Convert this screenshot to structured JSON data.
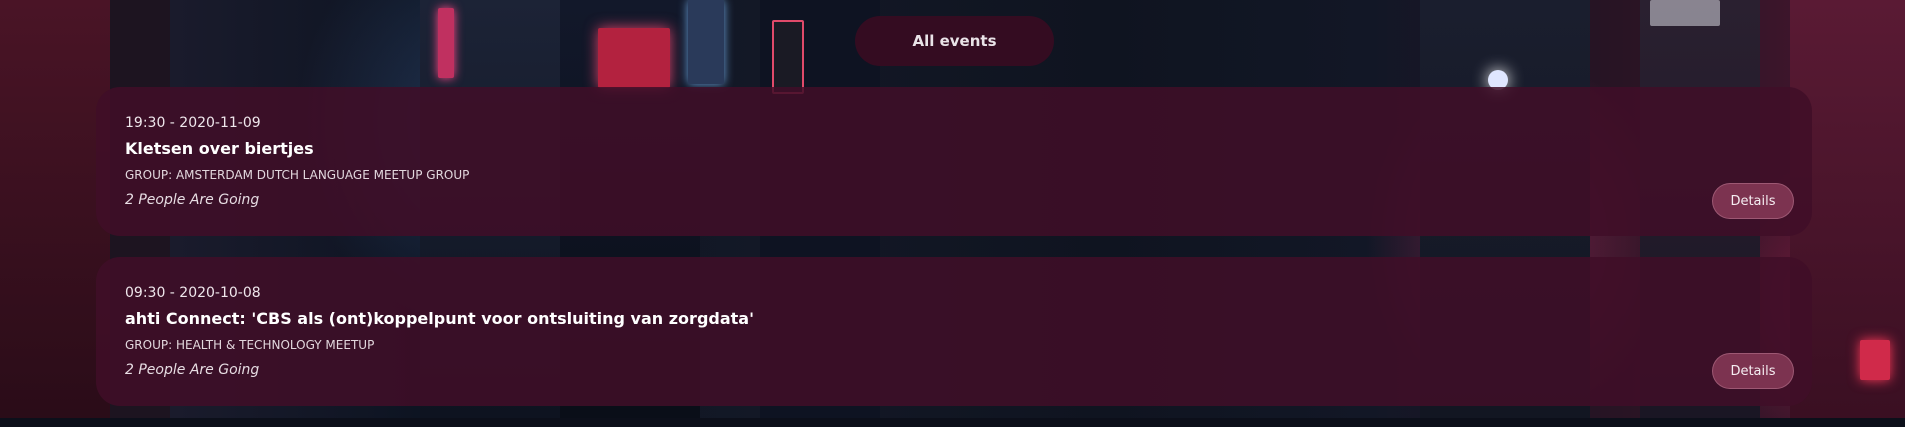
{
  "filter": {
    "label": "All events"
  },
  "events": [
    {
      "datetime": "19:30 - 2020-11-09",
      "title": "Kletsen over biertjes",
      "group": "GROUP: AMSTERDAM DUTCH LANGUAGE MEETUP GROUP",
      "attendees": "2 People Are Going",
      "details_label": "Details"
    },
    {
      "datetime": "09:30 - 2020-10-08",
      "title": "ahti Connect: 'CBS als (ont)koppelpunt voor ontsluiting van zorgdata'",
      "group": "GROUP: HEALTH & TECHNOLOGY MEETUP",
      "attendees": "2 People Are Going",
      "details_label": "Details"
    }
  ],
  "colors": {
    "card_background": "#400e28",
    "pill_background": "#370c22",
    "details_button": "#7c3350",
    "text": "#f1eaee"
  }
}
